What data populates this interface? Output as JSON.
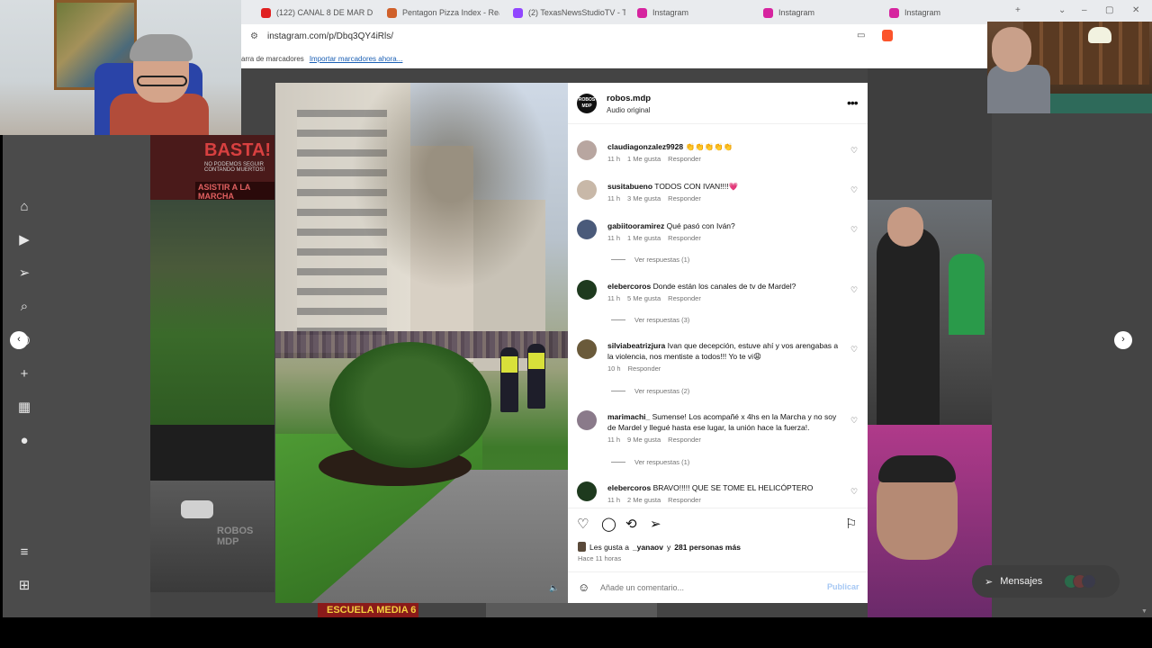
{
  "browser": {
    "tabs": [
      {
        "label": "(122) CANAL 8 DE MAR DEL P",
        "icon": "youtube-icon",
        "color": "#e02020"
      },
      {
        "label": "Pentagon Pizza Index - Real-T",
        "icon": "pizza-icon",
        "color": "#d0602a"
      },
      {
        "label": "(2) TexasNewsStudioTV - Twit",
        "icon": "twitch-icon",
        "color": "#9146ff"
      },
      {
        "label": "Instagram",
        "icon": "instagram-icon",
        "color": "#d6249f"
      },
      {
        "label": "Instagram",
        "icon": "instagram-icon",
        "color": "#d6249f"
      },
      {
        "label": "Instagram",
        "icon": "instagram-icon",
        "color": "#d6249f"
      }
    ],
    "url": "instagram.com/p/Dbq3QY4iRls/",
    "bookmarks_text": "arra de marcadores",
    "bookmarks_link": "Importar marcadores ahora..."
  },
  "grid": {
    "basta_title": "BASTA!",
    "basta_sub": "NO PODEMOS SEGUIR CONTANDO MUERTOS!",
    "basta_cta": "ASISTIR A LA MARCHA",
    "street_watermark": "ROBOS MDP",
    "bottom_tile": "ESCUELA MEDIA 6"
  },
  "post": {
    "username": "robos.mdp",
    "audio": "Audio original",
    "logo_text": "ROBOS MDP",
    "comments": [
      {
        "user": "claudiagonzalez9928",
        "text": "👏👏👏👏👏",
        "time": "11 h",
        "likes": "1 Me gusta",
        "reply": "Responder",
        "avatar": "#b8a6a0"
      },
      {
        "user": "susitabueno",
        "text": "TODOS CON IVAN!!!!💗",
        "time": "11 h",
        "likes": "3 Me gusta",
        "reply": "Responder",
        "avatar": "#c8b8a8"
      },
      {
        "user": "gabiitooramirez",
        "text": "Qué pasó con Iván?",
        "time": "11 h",
        "likes": "1 Me gusta",
        "reply": "Responder",
        "avatar": "#4a5a7a",
        "view_replies": "Ver respuestas (1)"
      },
      {
        "user": "elebercoros",
        "text": "Donde están los canales de tv de Mardel?",
        "time": "11 h",
        "likes": "5 Me gusta",
        "reply": "Responder",
        "avatar": "#1e3a1e",
        "view_replies": "Ver respuestas (3)"
      },
      {
        "user": "silviabeatrizjura",
        "text": "Ivan que decepción, estuve ahí y vos arengabas a la violencia, nos mentiste a todos!!! Yo te vi😩",
        "time": "10 h",
        "likes": "",
        "reply": "Responder",
        "avatar": "#6a5a3a",
        "view_replies": "Ver respuestas (2)"
      },
      {
        "user": "marimachi_",
        "text": "Sumense! Los acompañé x 4hs en la Marcha y no soy de Mardel y llegué hasta ese lugar, la unión hace la fuerza!.",
        "time": "11 h",
        "likes": "9 Me gusta",
        "reply": "Responder",
        "avatar": "#8a7a8a",
        "view_replies": "Ver respuestas (1)"
      },
      {
        "user": "elebercoros",
        "text": "BRAVO!!!!! QUE SE TOME EL HELICÓPTERO",
        "time": "11 h",
        "likes": "2 Me gusta",
        "reply": "Responder",
        "avatar": "#1e3a1e"
      }
    ],
    "likes_prefix": "Les gusta a",
    "likes_user": "_yanaov",
    "likes_conj": "y",
    "likes_rest": "281 personas más",
    "posted_ago": "Hace 11 horas",
    "comment_placeholder": "Añade un comentario...",
    "publish": "Publicar"
  },
  "messages_label": "Mensajes"
}
